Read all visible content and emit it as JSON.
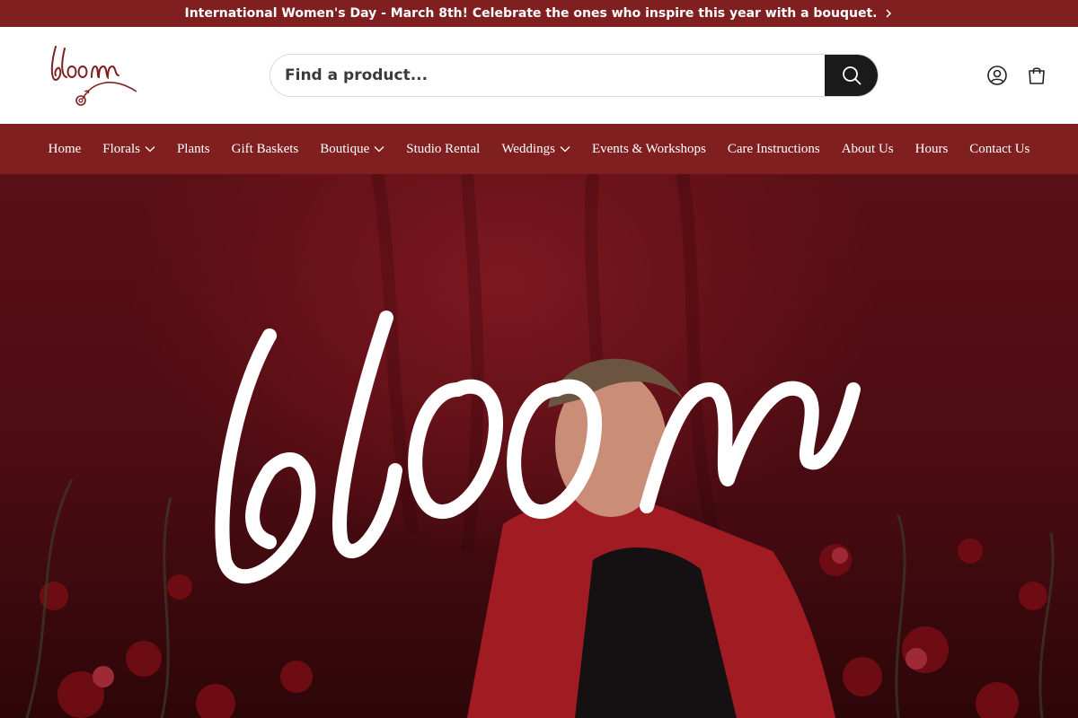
{
  "announcement": {
    "text": "International Women's Day - March 8th! Celebrate the ones who inspire this year with a bouquet."
  },
  "header": {
    "logo_text": "bloom",
    "search": {
      "placeholder": "Find a product...",
      "value": ""
    },
    "icons": {
      "search": "search-icon",
      "account": "account-icon",
      "cart": "cart-icon"
    }
  },
  "nav": {
    "items": [
      {
        "label": "Home",
        "dropdown": false
      },
      {
        "label": "Florals",
        "dropdown": true
      },
      {
        "label": "Plants",
        "dropdown": false
      },
      {
        "label": "Gift Baskets",
        "dropdown": false
      },
      {
        "label": "Boutique",
        "dropdown": true
      },
      {
        "label": "Studio Rental",
        "dropdown": false
      },
      {
        "label": "Weddings",
        "dropdown": true
      },
      {
        "label": "Events & Workshops",
        "dropdown": false
      },
      {
        "label": "Care Instructions",
        "dropdown": false
      },
      {
        "label": "About Us",
        "dropdown": false
      },
      {
        "label": "Hours",
        "dropdown": false
      },
      {
        "label": "Contact Us",
        "dropdown": false
      }
    ]
  },
  "hero": {
    "wordmark": "bloom"
  },
  "colors": {
    "brand": "#7f1f20",
    "search_button": "#1a1a1a",
    "hero_bg": "#4a0c12"
  }
}
